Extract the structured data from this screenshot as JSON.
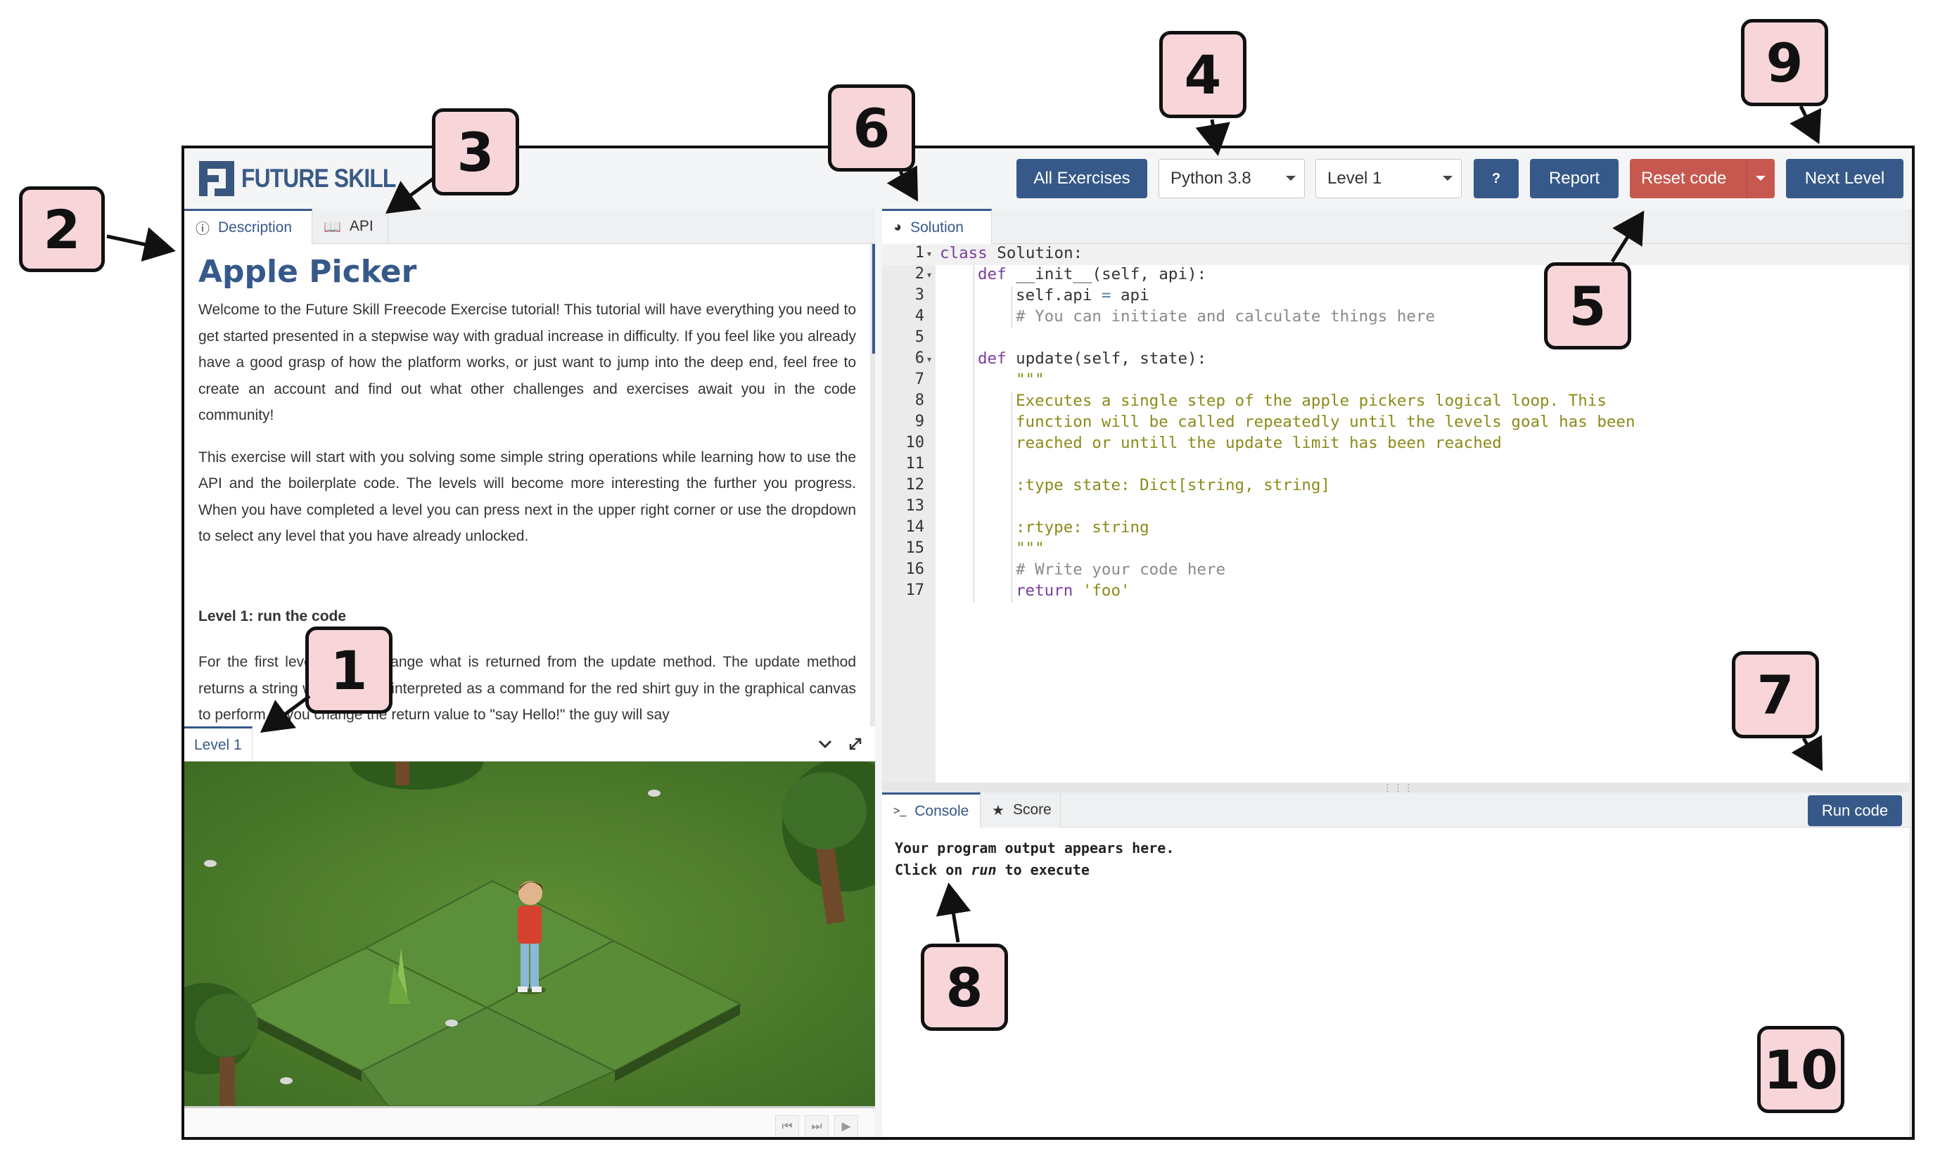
{
  "header": {
    "logo_text": "FUTURE SKILL",
    "all_exercises": "All Exercises",
    "language": "Python 3.8",
    "level": "Level 1",
    "help": "?",
    "report": "Report",
    "reset": "Reset code",
    "next_level": "Next Level"
  },
  "left_tabs": [
    {
      "label": "Description",
      "icon": "info-circle-icon"
    },
    {
      "label": "API",
      "icon": "book-icon"
    }
  ],
  "description": {
    "title": "Apple Picker",
    "p1": "Welcome to the Future Skill Freecode Exercise tutorial! This tutorial will have everything you need to get started presented in a stepwise way with gradual increase in difficulty. If you feel like you already have a good grasp of how the platform works, or just want to jump into the deep end, feel free to create an account and find out what other challenges and exercises await you in the code community!",
    "p2": "This exercise will start with you solving some simple string operations while learning how to use the API and the boilerplate code. The levels will become more interesting the further you progress. When you have completed a level you can press next in the upper right corner or use the dropdown to select any level that you have already unlocked.",
    "level_heading": "Level 1: run the code",
    "p3": "For the first level, simply change what is returned from the update method. The update method returns a string which will be interpreted as a command for the red shirt guy in the graphical canvas to perform. If you change the return value to \"say Hello!\" the guy will say"
  },
  "level_panel": {
    "tab": "Level 1"
  },
  "editor": {
    "tab": "Solution",
    "lines": [
      "1",
      "2",
      "3",
      "4",
      "5",
      "6",
      "7",
      "8",
      "9",
      "10",
      "11",
      "12",
      "13",
      "14",
      "15",
      "16",
      "17"
    ],
    "code": {
      "l1_kw": "class",
      "l1_rest": " Solution:",
      "l2_kw": "def",
      "l2_rest": " __init__(self, api):",
      "l3_a": "self.api ",
      "l3_op": "=",
      "l3_b": " api",
      "l4": "# You can initiate and calculate things here",
      "l6_kw": "def",
      "l6_rest": " update(self, state):",
      "l7": "\"\"\"",
      "l8": "Executes a single step of the apple pickers logical loop. This",
      "l9": "function will be called repeatedly until the levels goal has been",
      "l10": "reached or untill the update limit has been reached",
      "l12": ":type state: Dict[string, string]",
      "l14": ":rtype: string",
      "l15": "\"\"\"",
      "l16": "# Write your code here",
      "l17_kw": "return",
      "l17_str": " 'foo'"
    }
  },
  "console": {
    "tabs": [
      {
        "label": "Console",
        "icon": "terminal-icon"
      },
      {
        "label": "Score",
        "icon": "star-icon"
      }
    ],
    "run": "Run code",
    "line1": "Your program output appears here.",
    "line2_a": "Click on ",
    "line2_em": "run",
    "line2_b": " to execute"
  },
  "callouts": [
    "1",
    "2",
    "3",
    "4",
    "5",
    "6",
    "7",
    "8",
    "9",
    "10"
  ],
  "colors": {
    "primary": "#36598a",
    "danger": "#c7584f",
    "callout": "#f7d5d9"
  }
}
